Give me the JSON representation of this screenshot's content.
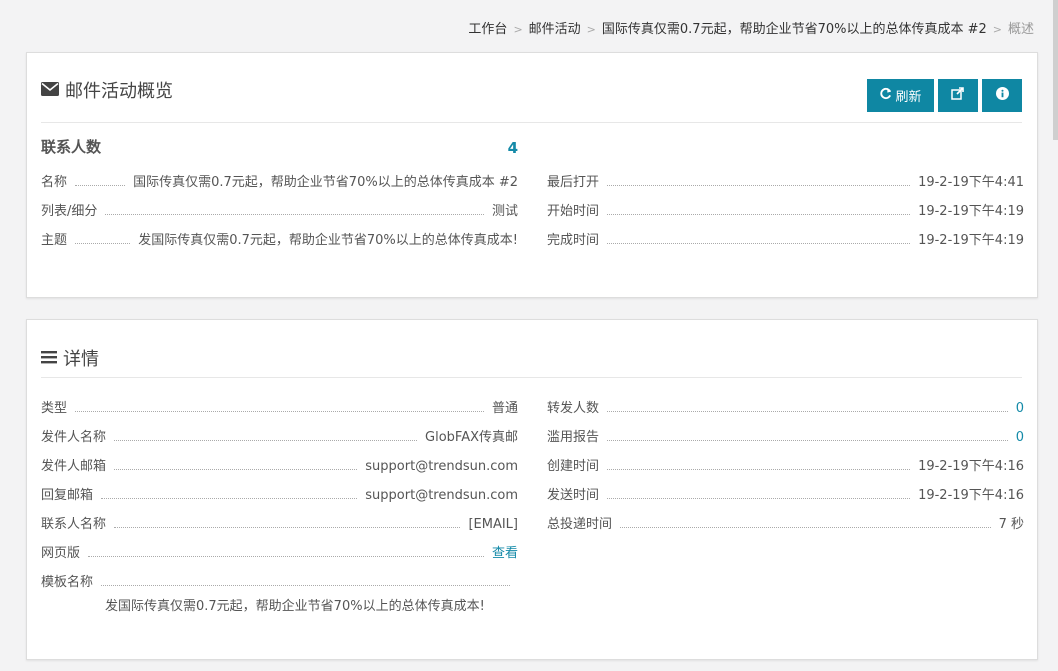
{
  "breadcrumb": {
    "items": [
      "工作台",
      "邮件活动",
      "国际传真仅需0.7元起，帮助企业节省70%以上的总体传真成本 #2"
    ],
    "current": "概述",
    "separator": ">"
  },
  "overview": {
    "title": "邮件活动概览",
    "icon": "envelope-icon",
    "buttons": {
      "refresh_label": "刷新",
      "share_icon": "share-icon",
      "info_icon": "info-icon"
    },
    "contacts_label": "联系人数",
    "contacts_value": "4",
    "left": [
      {
        "label": "名称",
        "value": "国际传真仅需0.7元起，帮助企业节省70%以上的总体传真成本 #2"
      },
      {
        "label": "列表/细分",
        "value": "测试"
      },
      {
        "label": "主题",
        "value": "发国际传真仅需0.7元起，帮助企业节省70%以上的总体传真成本!"
      }
    ],
    "right": [
      {
        "label": "最后打开",
        "value": "19-2-19下午4:41"
      },
      {
        "label": "开始时间",
        "value": "19-2-19下午4:19"
      },
      {
        "label": "完成时间",
        "value": "19-2-19下午4:19"
      }
    ]
  },
  "details": {
    "title": "详情",
    "icon": "list-icon",
    "left": [
      {
        "label": "类型",
        "value": "普通"
      },
      {
        "label": "发件人名称",
        "value": "GlobFAX传真邮"
      },
      {
        "label": "发件人邮箱",
        "value": "support@trendsun.com"
      },
      {
        "label": "回复邮箱",
        "value": "support@trendsun.com"
      },
      {
        "label": "联系人名称",
        "value": "[EMAIL]"
      },
      {
        "label": "网页版",
        "value": "查看"
      },
      {
        "label": "模板名称",
        "value": ""
      }
    ],
    "template_name_value": "发国际传真仅需0.7元起，帮助企业节省70%以上的总体传真成本!",
    "right": [
      {
        "label": "转发人数",
        "value": "0"
      },
      {
        "label": "滥用报告",
        "value": "0"
      },
      {
        "label": "创建时间",
        "value": "19-2-19下午4:16"
      },
      {
        "label": "发送时间",
        "value": "19-2-19下午4:16"
      },
      {
        "label": "总投递时间",
        "value": "7 秒"
      }
    ]
  },
  "colors": {
    "accent": "#0f87a3",
    "link": "#148aa8",
    "background": "#f3f3f4"
  }
}
